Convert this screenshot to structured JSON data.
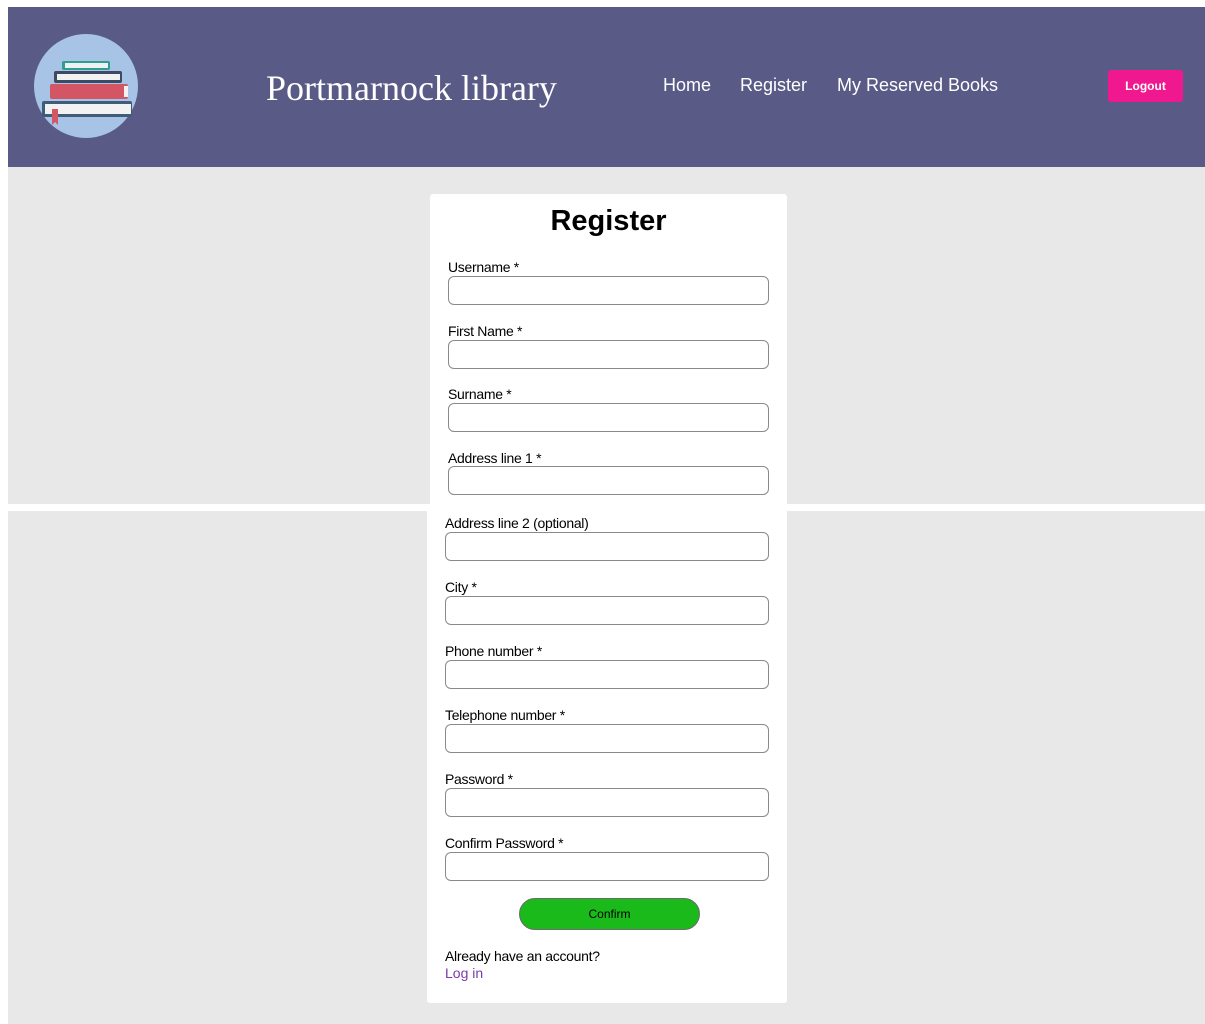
{
  "header": {
    "title": "Portmarnock library",
    "logo_icon": "book-stack-icon",
    "nav": [
      {
        "label": "Home"
      },
      {
        "label": "Register"
      },
      {
        "label": "My Reserved Books"
      }
    ],
    "logout_label": "Logout"
  },
  "form": {
    "title": "Register",
    "fields": [
      {
        "label": "Username *",
        "value": ""
      },
      {
        "label": "First Name *",
        "value": ""
      },
      {
        "label": "Surname *",
        "value": ""
      },
      {
        "label": "Address line 1 *",
        "value": ""
      },
      {
        "label": "Address line 2 (optional)",
        "value": ""
      },
      {
        "label": "City *",
        "value": ""
      },
      {
        "label": "Phone number *",
        "value": ""
      },
      {
        "label": "Telephone number *",
        "value": ""
      },
      {
        "label": "Password *",
        "value": ""
      },
      {
        "label": "Confirm Password *",
        "value": ""
      }
    ],
    "confirm_label": "Confirm",
    "account_prompt": "Already have an account?",
    "login_label": "Log in"
  },
  "colors": {
    "header_bg": "#5a5a87",
    "page_bg": "#e8e8e8",
    "logout_bg": "#f0188e",
    "confirm_bg": "#1aba1a",
    "link_color": "#7a3aa8"
  }
}
